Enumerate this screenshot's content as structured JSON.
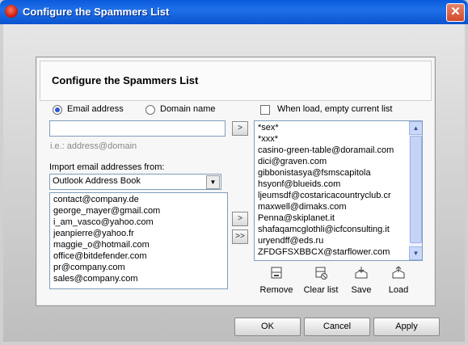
{
  "window": {
    "title": "Configure the Spammers List",
    "close_glyph": "✕"
  },
  "panel": {
    "title": "Configure the Spammers List"
  },
  "mode": {
    "email_label": "Email address",
    "domain_label": "Domain name",
    "selected": "email"
  },
  "empty_on_load": {
    "label": "When load, empty current list",
    "checked": false
  },
  "entry": {
    "value": "",
    "hint": "i.e.: address@domain"
  },
  "import": {
    "label": "Import email addresses from:",
    "source": "Outlook Address Book",
    "addresses": [
      "contact@company.de",
      "george_mayer@gmail.com",
      "i_am_vasco@yahoo.com",
      "jeanpierre@yahoo.fr",
      "maggie_o@hotmail.com",
      "office@bitdefender.com",
      "pr@company.com",
      "sales@company.com"
    ]
  },
  "spammers": [
    "*sex*",
    "*xxx*",
    "casino-green-table@doramail.com",
    "dici@graven.com",
    "gibbonistasya@fsmscapitola",
    "hsyonf@blueids.com",
    "ljeumsdf@costaricacountryclub.cr",
    "maxwell@dimaks.com",
    "Penna@skiplanet.it",
    "shafaqamcglothli@icfconsulting.it",
    "uryendff@eds.ru",
    "ZFDGFSXBBCX@starflower.com"
  ],
  "tools": {
    "remove": "Remove",
    "clear": "Clear list",
    "save": "Save",
    "load": "Load"
  },
  "buttons": {
    "ok": "OK",
    "cancel": "Cancel",
    "apply": "Apply"
  }
}
